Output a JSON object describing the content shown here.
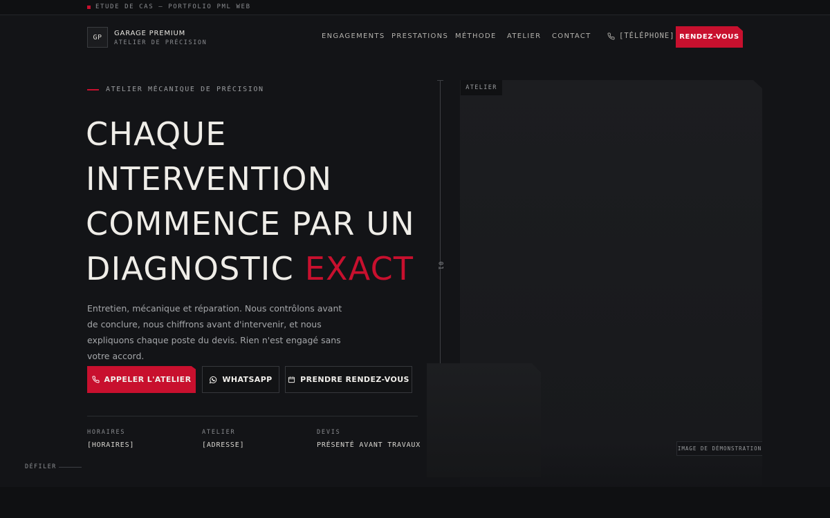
{
  "topstrip": {
    "text": "ETUDE DE CAS — PORTFOLIO PML WEB"
  },
  "header": {
    "logo": "GP",
    "brand_name": "GARAGE PREMIUM",
    "brand_sub": "ATELIER DE PRÉCISION",
    "nav": [
      "ENGAGEMENTS",
      "PRESTATIONS",
      "MÉTHODE",
      "ATELIER",
      "CONTACT"
    ],
    "phone": "[TÉLÉPHONE]",
    "cta": "RENDEZ-VOUS"
  },
  "hero": {
    "eyebrow": "ATELIER MÉCANIQUE DE PRÉCISION",
    "headline_lines": [
      "CHAQUE",
      "INTERVENTION",
      "COMMENCE PAR UN",
      "DIAGNOSTIC"
    ],
    "headline_accent": "EXACT",
    "lead": "Entretien, mécanique et réparation. Nous contrôlons avant de conclure, nous chiffrons avant d'intervenir, et nous expliquons chaque poste du devis. Rien n'est engagé sans votre accord.",
    "buttons": {
      "call": "APPELER L'ATELIER",
      "whatsapp": "WHATSAPP",
      "booking": "PRENDRE RENDEZ-VOUS"
    },
    "info": [
      {
        "label": "HORAIRES",
        "value": "[HORAIRES]"
      },
      {
        "label": "ATELIER",
        "value": "[ADRESSE]"
      },
      {
        "label": "DEVIS",
        "value": "PRÉSENTÉ AVANT TRAVAUX"
      }
    ],
    "scroll": "DÉFILER"
  },
  "visual": {
    "index": "01",
    "panel_tag": "ATELIER",
    "demo_tag": "IMAGE DE DÉMONSTRATION"
  },
  "colors": {
    "accent": "#c8102e",
    "background": "#131417"
  }
}
